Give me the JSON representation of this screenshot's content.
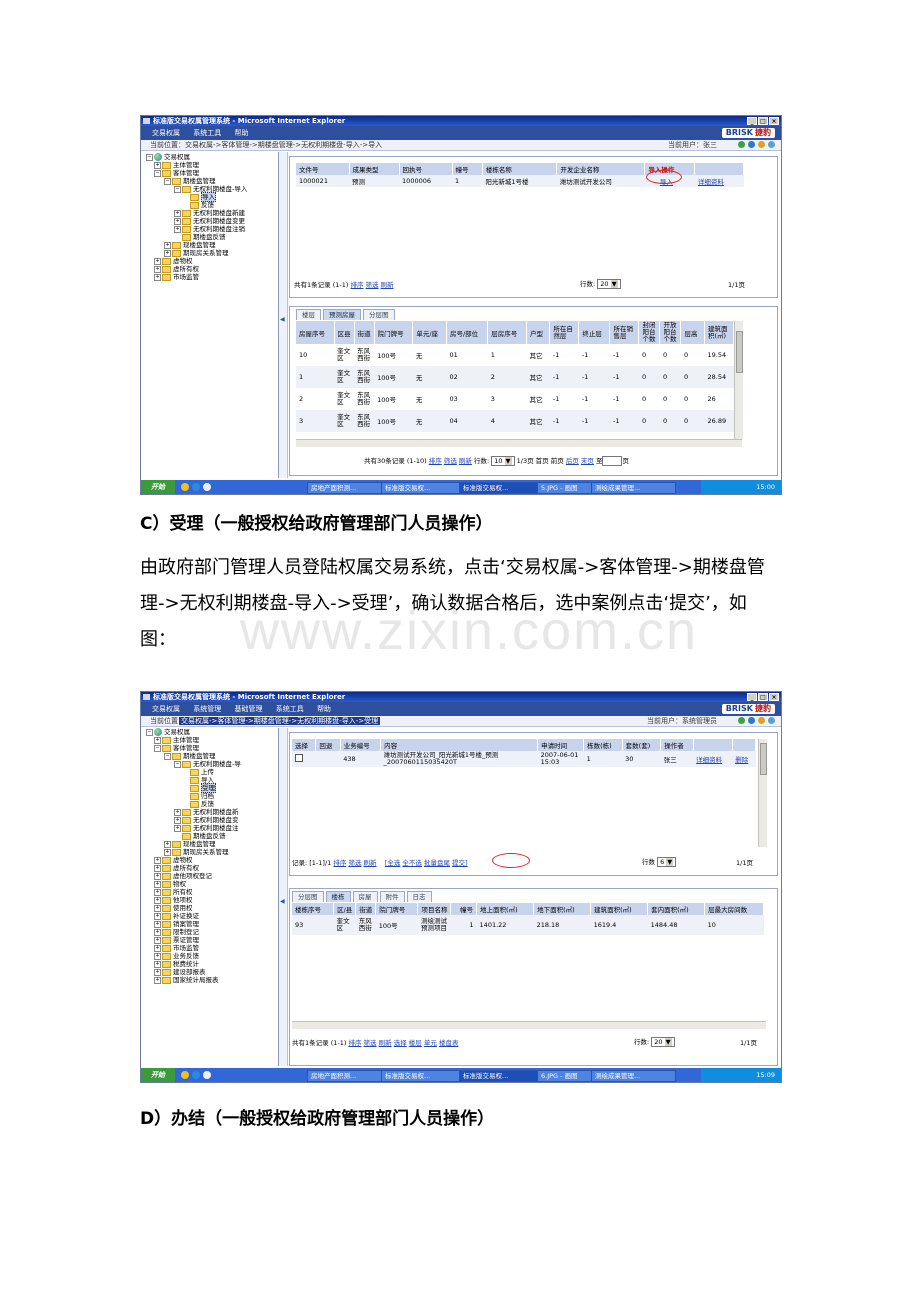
{
  "watermark": "www.zixin.com.cn",
  "common": {
    "window_title": "标准版交易权属管理系统 - Microsoft Internet Explorer",
    "logo_brand": "BRISK",
    "logo_cn": "捷豹",
    "win_buttons": [
      "_",
      "□",
      "×"
    ],
    "start_label": "开始"
  },
  "screenshot1": {
    "menu": [
      "交易权属",
      "系统工具",
      "帮助"
    ],
    "location": "当前位置：交易权属->客体管理->期楼盘管理->无权利期楼盘-导入->导入",
    "current_user": "当前用户：张三",
    "tree": [
      {
        "label": "交易权属",
        "type": "globe"
      },
      {
        "label": "主体管理",
        "type": "folder"
      },
      {
        "label": "客体管理",
        "type": "folder"
      },
      {
        "label": "期楼盘管理",
        "type": "folder"
      },
      {
        "label": "无权利期楼盘-导入",
        "type": "folder"
      },
      {
        "label": "导入",
        "type": "folder",
        "selected": true
      },
      {
        "label": "反馈",
        "type": "folder"
      },
      {
        "label": "无权利期楼盘新建",
        "type": "folder"
      },
      {
        "label": "无权利期楼盘变更",
        "type": "folder"
      },
      {
        "label": "无权利期楼盘注销",
        "type": "folder"
      },
      {
        "label": "期楼盘反馈",
        "type": "folder"
      },
      {
        "label": "现楼盘管理",
        "type": "folder"
      },
      {
        "label": "期现房关系管理",
        "type": "folder"
      },
      {
        "label": "虚物权",
        "type": "folder"
      },
      {
        "label": "虚所有权",
        "type": "folder"
      },
      {
        "label": "市场监管",
        "type": "folder"
      }
    ],
    "top_table": {
      "headers": [
        "文件号",
        "成果类型",
        "回执号",
        "幢号",
        "楼栋名称",
        "开发企业名称",
        "导入操作",
        ""
      ],
      "rows": [
        [
          "1000021",
          "预测",
          "1000006",
          "1",
          "阳光新城1号楼",
          "潍坊测试开发公司",
          "导入",
          "详细资料"
        ]
      ]
    },
    "top_pager": {
      "total": "共有1条记录 (1-1)",
      "sort": "排序",
      "filter": "筛选",
      "refresh": "刷新",
      "rows_label": "行数:",
      "rows_value": "20",
      "pages": "1/1页"
    },
    "tabs": [
      "楼层",
      "预测房屋",
      "分层图"
    ],
    "bottom_table": {
      "headers": [
        "房屋序号",
        "区县",
        "街道",
        "院门牌号",
        "单元/座",
        "房号/部位",
        "层房序号",
        "户型",
        "所在自然层",
        "终止层",
        "所在销售层",
        "封闭阳台个数",
        "开放阳台个数",
        "层高",
        "建筑面积(㎡)"
      ],
      "rows": [
        [
          "10",
          "奎文区",
          "东风西街",
          "100号",
          "无",
          "01",
          "1",
          "其它",
          "-1",
          "-1",
          "-1",
          "0",
          "0",
          "0",
          "19.54"
        ],
        [
          "1",
          "奎文区",
          "东风西街",
          "100号",
          "无",
          "02",
          "2",
          "其它",
          "-1",
          "-1",
          "-1",
          "0",
          "0",
          "0",
          "28.54"
        ],
        [
          "2",
          "奎文区",
          "东风西街",
          "100号",
          "无",
          "03",
          "3",
          "其它",
          "-1",
          "-1",
          "-1",
          "0",
          "0",
          "0",
          "26"
        ],
        [
          "3",
          "奎文区",
          "东风西街",
          "100号",
          "无",
          "04",
          "4",
          "其它",
          "-1",
          "-1",
          "-1",
          "0",
          "0",
          "0",
          "26.89"
        ]
      ]
    },
    "bottom_pager": {
      "total": "共有30条记录 (1-10)",
      "sort": "排序",
      "filter": "筛选",
      "refresh": "刷新",
      "rows_label": "行数:",
      "rows_value": "10",
      "pages": "1/3页",
      "first": "首页",
      "prev": "前页",
      "next": "后页",
      "last": "末页",
      "goto": "至",
      "goto_unit": "页"
    },
    "taskbar_tasks": [
      "房地产面积测...",
      "标准版交易权...",
      "标准版交易权...",
      "5.JPG - 画图",
      "测绘成果管理..."
    ],
    "clock": "15:00"
  },
  "sectionC": {
    "heading": "C）受理（一般授权给政府管理部门人员操作）",
    "paragraph": "由政府部门管理人员登陆权属交易系统，点击‘交易权属->客体管理->期楼盘管理->无权利期楼盘-导入->受理’，确认数据合格后，选中案例点击‘提交’，如图："
  },
  "screenshot2": {
    "menu": [
      "交易权属",
      "系统管理",
      "基础管理",
      "系统工具",
      "帮助"
    ],
    "location_prefix": "当前位置：",
    "location": "交易权属->客体管理->期楼盘管理->无权利期楼盘-导入->受理",
    "current_user": "当前用户：系统管理员",
    "tree": [
      {
        "label": "交易权属",
        "type": "globe"
      },
      {
        "label": "主体管理",
        "type": "folder"
      },
      {
        "label": "客体管理",
        "type": "folder"
      },
      {
        "label": "期楼盘管理",
        "type": "folder"
      },
      {
        "label": "无权利期楼盘-导",
        "type": "folder"
      },
      {
        "label": "上传",
        "type": "folder"
      },
      {
        "label": "导入",
        "type": "folder"
      },
      {
        "label": "受理",
        "type": "folder",
        "selected": true
      },
      {
        "label": "归档",
        "type": "folder"
      },
      {
        "label": "反馈",
        "type": "folder"
      },
      {
        "label": "无权利期楼盘新",
        "type": "folder"
      },
      {
        "label": "无权利期楼盘变",
        "type": "folder"
      },
      {
        "label": "无权利期楼盘注",
        "type": "folder"
      },
      {
        "label": "期楼盘反馈",
        "type": "folder"
      },
      {
        "label": "现楼盘管理",
        "type": "folder"
      },
      {
        "label": "期现房关系管理",
        "type": "folder"
      },
      {
        "label": "虚物权",
        "type": "folder"
      },
      {
        "label": "虚所有权",
        "type": "folder"
      },
      {
        "label": "虚他项权登记",
        "type": "folder"
      },
      {
        "label": "物权",
        "type": "folder"
      },
      {
        "label": "所有权",
        "type": "folder"
      },
      {
        "label": "他项权",
        "type": "folder"
      },
      {
        "label": "使用权",
        "type": "folder"
      },
      {
        "label": "补证换证",
        "type": "folder"
      },
      {
        "label": "销案管理",
        "type": "folder"
      },
      {
        "label": "限制登记",
        "type": "folder"
      },
      {
        "label": "票证管理",
        "type": "folder"
      },
      {
        "label": "市场监管",
        "type": "folder"
      },
      {
        "label": "业务反馈",
        "type": "folder"
      },
      {
        "label": "税费统计",
        "type": "folder"
      },
      {
        "label": "建设部报表",
        "type": "folder"
      },
      {
        "label": "国家统计局报表",
        "type": "folder"
      }
    ],
    "top_table": {
      "headers": [
        "选择",
        "回退",
        "业务编号",
        "内容",
        "申请时间",
        "栋数(栋)",
        "套数(套)",
        "操作者",
        "",
        ""
      ],
      "rows": [
        [
          "",
          "",
          "438",
          "潍坊测试开发公司_阳光新城1号楼_预测_2007060115035420T",
          "2007-06-01 15:03",
          "1",
          "30",
          "张三",
          "详细资料",
          "删除"
        ]
      ]
    },
    "top_pager": {
      "total": "记录: [1-1]/1",
      "sort": "排序",
      "filter": "筛选",
      "refresh": "刷新",
      "select_all": "[全选",
      "select_none": "全不选",
      "batch": "批量盘尾",
      "submit": "提交]",
      "rows_label": "行数",
      "rows_value": "6",
      "pages": "1/1页"
    },
    "tabs": [
      "分层图",
      "楼栋",
      "房屋",
      "附件",
      "日志"
    ],
    "bottom_table": {
      "headers": [
        "楼栋序号",
        "区/县",
        "街道",
        "院门牌号",
        "项目名称",
        "幢号",
        "地上面积(㎡)",
        "地下面积(㎡)",
        "建筑面积(㎡)",
        "套内面积(㎡)",
        "层最大房间数"
      ],
      "rows": [
        [
          "93",
          "奎文区",
          "东风西街",
          "100号",
          "测绘测试预测项目",
          "1",
          "1401.22",
          "218.18",
          "1619.4",
          "1484.48",
          "10"
        ]
      ]
    },
    "bottom_pager": {
      "total": "共有1条记录 (1-1)",
      "sort": "排序",
      "filter": "筛选",
      "refresh": "刷新",
      "select": "选择",
      "floor": "楼层",
      "unit": "单元",
      "building_table": "楼盘表",
      "rows_label": "行数:",
      "rows_value": "20",
      "pages": "1/1页"
    },
    "taskbar_tasks": [
      "房地产面积测...",
      "标准版交易权...",
      "标准版交易权...",
      "6.JPG - 画图",
      "测绘成果管理..."
    ],
    "clock": "15:09"
  },
  "sectionD": {
    "heading": "D）办结（一般授权给政府管理部门人员操作）"
  }
}
